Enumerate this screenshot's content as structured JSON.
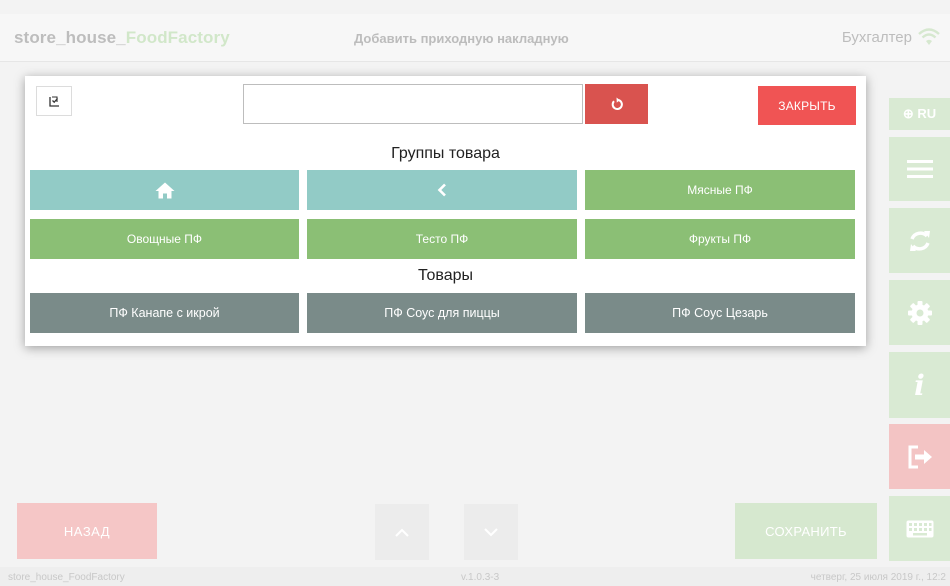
{
  "header": {
    "app_name_prefix": "store_house_",
    "app_name_accent": "FoodFactory",
    "page_title": "Добавить приходную накладную",
    "user_role": "Бухгалтер",
    "wifi_icon": "wifi-icon"
  },
  "sidebar": {
    "language": "⊕ RU",
    "items": [
      {
        "name": "menu",
        "icon": "hamburger-icon"
      },
      {
        "name": "sync",
        "icon": "sync-icon"
      },
      {
        "name": "settings",
        "icon": "gear-icon"
      },
      {
        "name": "info",
        "icon": "info-icon",
        "glyph": "i"
      },
      {
        "name": "logout",
        "icon": "logout-icon"
      },
      {
        "name": "keyboard",
        "icon": "keyboard-icon"
      }
    ]
  },
  "modal": {
    "select_all_icon": "checklist-icon",
    "search_value": "",
    "search_placeholder": "",
    "reset_icon": "undo-icon",
    "close_label": "ЗАКРЫТЬ",
    "groups_heading": "Группы товара",
    "groups": [
      {
        "label": "",
        "icon": "home-icon",
        "style": "teal"
      },
      {
        "label": "",
        "icon": "chevron-left-icon",
        "style": "teal"
      },
      {
        "label": "Мясные ПФ",
        "style": "green"
      },
      {
        "label": "Овощные ПФ",
        "style": "green"
      },
      {
        "label": "Тесто ПФ",
        "style": "green"
      },
      {
        "label": "Фрукты ПФ",
        "style": "green"
      }
    ],
    "goods_heading": "Товары",
    "goods": [
      {
        "label": "ПФ Канапе с икрой"
      },
      {
        "label": "ПФ Соус для пиццы"
      },
      {
        "label": "ПФ Соус Цезарь"
      }
    ]
  },
  "bottom": {
    "back_label": "НАЗАД",
    "up_icon": "chevron-up-icon",
    "down_icon": "chevron-down-icon",
    "save_label": "СОХРАНИТЬ"
  },
  "footer": {
    "left": "store_house_FoodFactory",
    "version": "v.1.0.3-3",
    "datetime": "четверг, 25 июля 2019 г., 12:2"
  },
  "colors": {
    "teal": "#92cbc6",
    "green": "#8bbf75",
    "slate": "#7a8b89",
    "danger": "#f05454",
    "reset": "#d9534f"
  }
}
